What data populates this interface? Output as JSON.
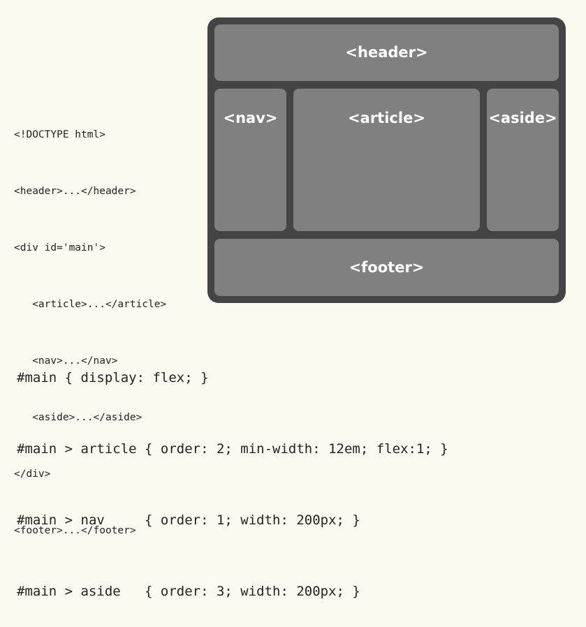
{
  "markup_lines": [
    "<!DOCTYPE html>",
    "<header>...</header>",
    "<div id='main'>",
    "   <article>...</article>",
    "   <nav>...</nav>",
    "   <aside>...</aside>",
    "</div>",
    "<footer>...</footer>"
  ],
  "layout_boxes": {
    "header": "<header>",
    "nav": "<nav>",
    "article": "<article>",
    "aside": "<aside>",
    "footer": "<footer>"
  },
  "css_lines": [
    "#main { display: flex; }",
    "#main > article { order: 2; min-width: 12em; flex:1; }",
    "#main > nav     { order: 1; width: 200px; }",
    "#main > aside   { order: 3; width: 200px; }"
  ],
  "colors": {
    "background": "#fcfaf0",
    "frame": "#444444",
    "box": "#808080",
    "box_text": "#ffffff"
  }
}
